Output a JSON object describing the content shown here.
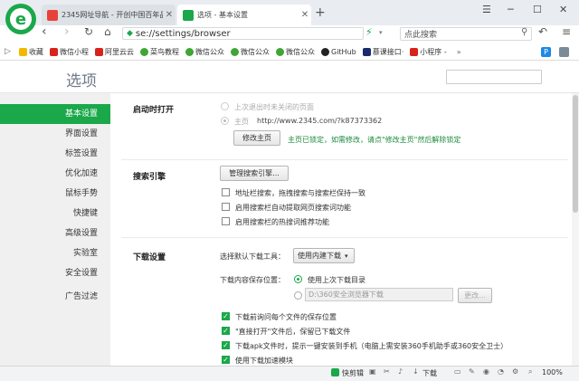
{
  "tabs": [
    {
      "label": "2345网址导航 - 开创中国百年品",
      "icon_color": "#e8423b"
    },
    {
      "label": "选项 - 基本设置",
      "icon_color": "#1aa84a"
    }
  ],
  "new_tab_symbol": "+",
  "address": {
    "url": "se://settings/browser",
    "search_placeholder": "点此搜索"
  },
  "bookmarks": [
    {
      "label": "收藏",
      "color": "#f5b800"
    },
    {
      "label": "微信小程",
      "color": "#d8231b"
    },
    {
      "label": "阿里云云",
      "color": "#d8231b"
    },
    {
      "label": "菜鸟教程",
      "color": "#3fa535"
    },
    {
      "label": "微信公众",
      "color": "#3fa535"
    },
    {
      "label": "微信公众",
      "color": "#3fa535"
    },
    {
      "label": "微信公众",
      "color": "#3fa535"
    },
    {
      "label": "GitHub",
      "color": "#222222"
    },
    {
      "label": "慕课接口·",
      "color": "#1a2a6c"
    },
    {
      "label": "小程序 -",
      "color": "#d8231b"
    }
  ],
  "settings_title": "选项",
  "sidebar": [
    {
      "label": "基本设置",
      "active": true
    },
    {
      "label": "界面设置",
      "active": false
    },
    {
      "label": "标签设置",
      "active": false
    },
    {
      "label": "优化加速",
      "active": false
    },
    {
      "label": "鼠标手势",
      "active": false
    },
    {
      "label": "快捷键",
      "active": false
    },
    {
      "label": "高级设置",
      "active": false
    },
    {
      "label": "实验室",
      "active": false
    },
    {
      "label": "安全设置",
      "active": false
    },
    {
      "label": "广告过滤",
      "active": false
    }
  ],
  "startup": {
    "heading": "启动时打开",
    "option_restore": "上次退出时未关闭的页面",
    "option_home": "主页",
    "home_url": "http://www.2345.com/?k87373362",
    "modify_button": "修改主页",
    "locked_note": "主页已锁定，如需修改，请点\"修改主页\"然后解除锁定"
  },
  "search": {
    "heading": "搜索引擎",
    "manage_button": "管理搜索引擎...",
    "options": [
      "地址栏搜索，拖拽搜索与搜索栏保持一致",
      "启用搜索栏自动提取网页搜索词功能",
      "启用搜索栏的热搜词推荐功能"
    ]
  },
  "download": {
    "heading": "下载设置",
    "tool_label": "选择默认下载工具：",
    "tool_value": "使用内建下载",
    "save_label": "下载内容保存位置：",
    "save_last": "使用上次下载目录",
    "save_path": "D:\\360安全浏览器下载",
    "change_button": "更改...",
    "options": [
      "下载前询问每个文件的保存位置",
      "\"直接打开\"文件后，保留已下载文件",
      "下载apk文件时，提示一键安装到手机（电脑上需安装360手机助手或360安全卫士）",
      "使用下载加速模块"
    ]
  },
  "statusbar": {
    "quick_clip": "快剪辑",
    "download": "下载",
    "zoom": "100%"
  },
  "colors": {
    "accent": "#1aa84a"
  }
}
